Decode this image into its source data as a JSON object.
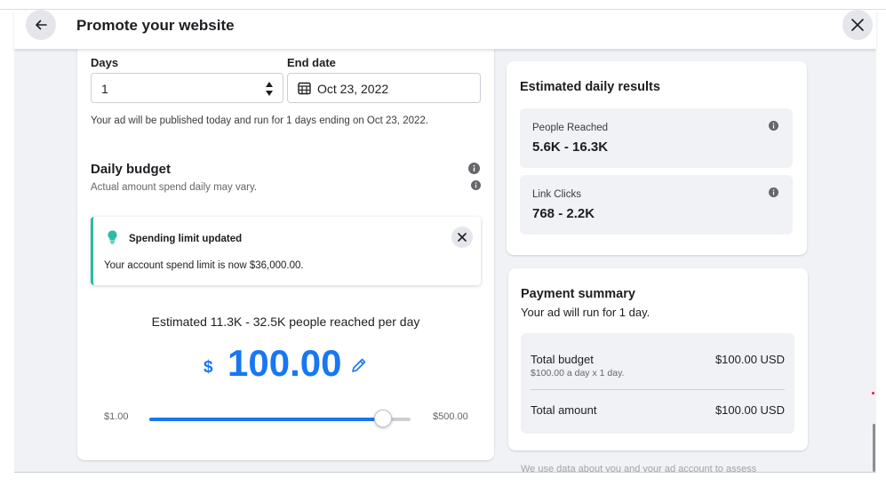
{
  "header": {
    "title": "Promote your website"
  },
  "duration": {
    "days_label": "Days",
    "days_value": "1",
    "end_date_label": "End date",
    "end_date_value": "Oct 23, 2022",
    "note": "Your ad will be published today and run for 1 days ending on Oct 23, 2022."
  },
  "budget": {
    "title": "Daily budget",
    "subtitle": "Actual amount spend daily may vary.",
    "alert": {
      "title": "Spending limit updated",
      "text": "Your account spend limit is now $36,000.00."
    },
    "estimate": "Estimated 11.3K - 32.5K people reached per day",
    "currency_symbol": "$",
    "amount": "100.00",
    "slider_min_label": "$1.00",
    "slider_max_label": "$500.00",
    "slider_fraction": 0.893
  },
  "results": {
    "title": "Estimated daily results",
    "metrics": [
      {
        "label": "People Reached",
        "value": "5.6K - 16.3K"
      },
      {
        "label": "Link Clicks",
        "value": "768 - 2.2K"
      }
    ]
  },
  "payment": {
    "title": "Payment summary",
    "subtitle": "Your ad will run for 1 day.",
    "total_budget_label": "Total budget",
    "total_budget_value": "$100.00 USD",
    "total_budget_detail": "$100.00 a day x 1 day.",
    "total_amount_label": "Total amount",
    "total_amount_value": "$100.00 USD"
  },
  "footer_note": "We use data about you and your ad account to assess",
  "colors": {
    "accent": "#1877f2",
    "alert_border": "#2abba7",
    "panel_bg": "#f0f2f5"
  }
}
